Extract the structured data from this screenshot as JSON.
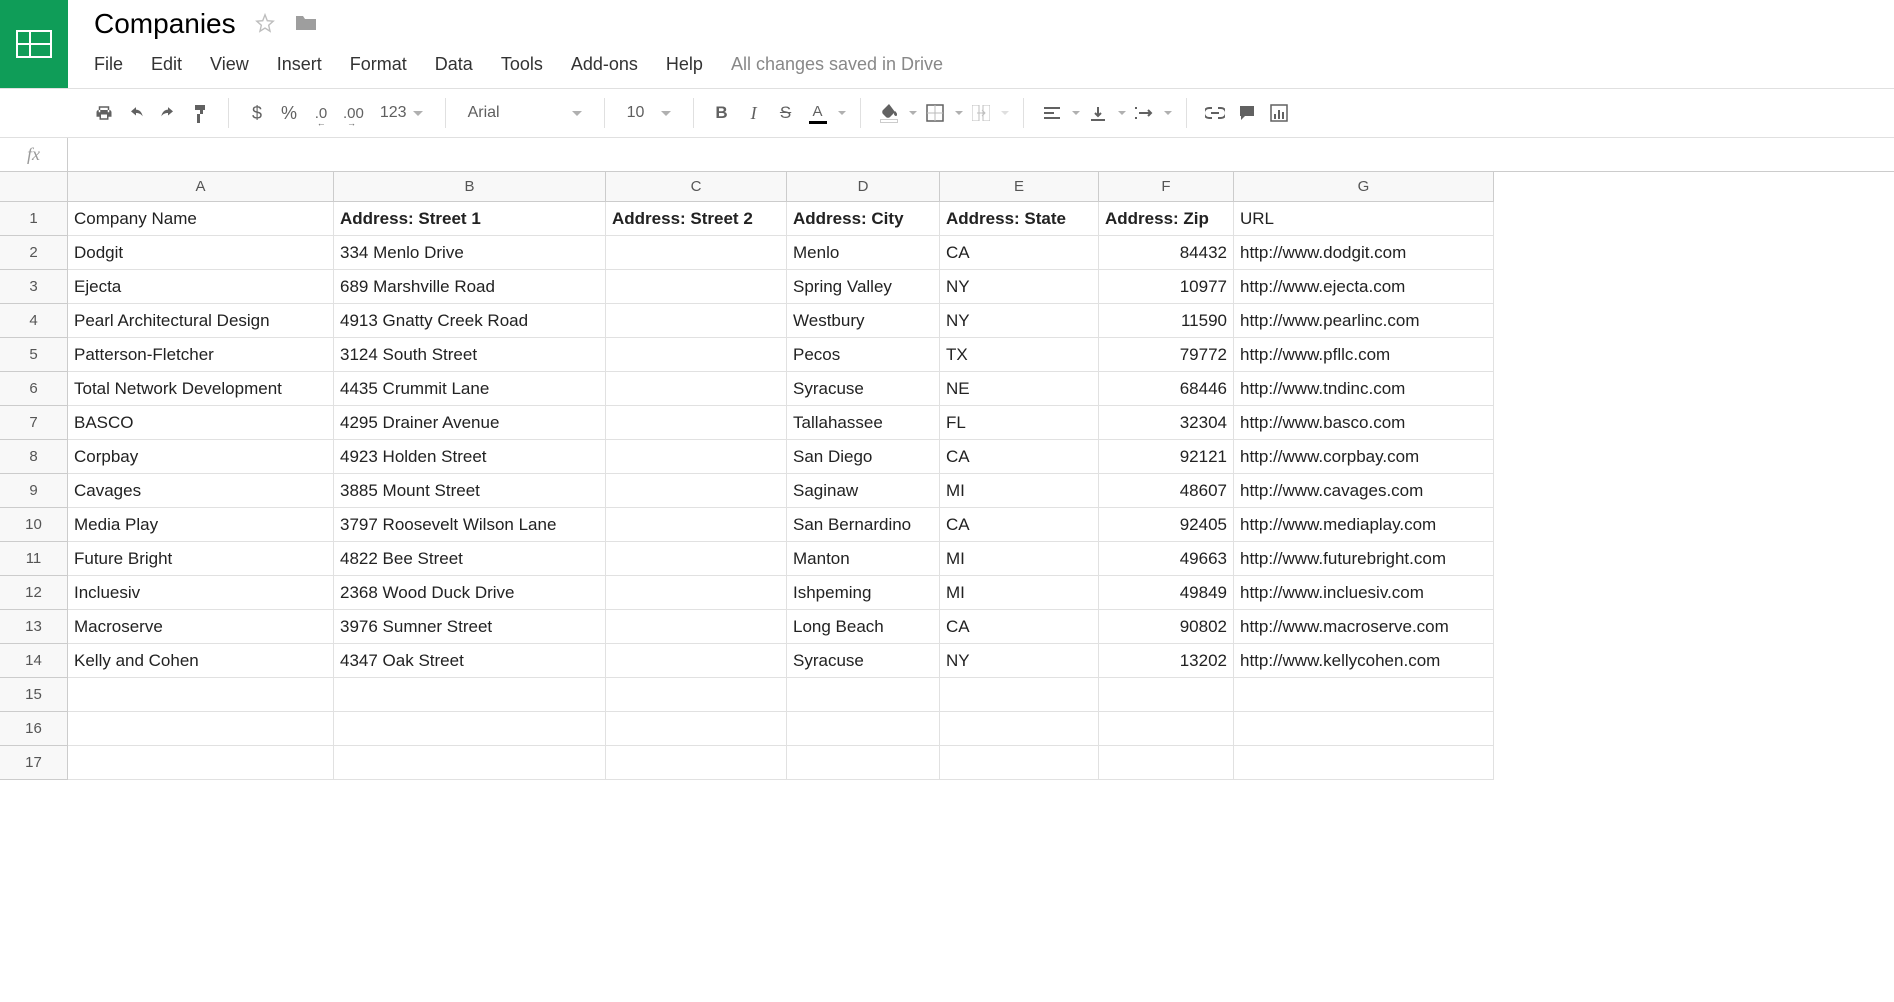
{
  "title": "Companies",
  "menu": {
    "file": "File",
    "edit": "Edit",
    "view": "View",
    "insert": "Insert",
    "format": "Format",
    "data": "Data",
    "tools": "Tools",
    "addons": "Add-ons",
    "help": "Help"
  },
  "save_status": "All changes saved in Drive",
  "toolbar": {
    "currency": "$",
    "percent": "%",
    "dec_dec": ".0",
    "dec_inc": ".00",
    "format_more": "123",
    "font": "Arial",
    "font_size": "10",
    "bold": "B",
    "italic": "I",
    "strike": "S"
  },
  "formula_label": "fx",
  "columns": [
    "A",
    "B",
    "C",
    "D",
    "E",
    "F",
    "G"
  ],
  "col_widths": [
    "cA",
    "cB",
    "cC",
    "cD",
    "cE",
    "cF",
    "cG"
  ],
  "headers": {
    "a": "Company Name",
    "b": "Address: Street 1",
    "c": "Address: Street 2",
    "d": "Address: City",
    "e": "Address: State",
    "f": "Address: Zip",
    "g": "URL"
  },
  "rows": [
    {
      "a": "Dodgit",
      "b": "334 Menlo Drive",
      "c": "",
      "d": "Menlo",
      "e": "CA",
      "f": "84432",
      "g": "http://www.dodgit.com"
    },
    {
      "a": "Ejecta",
      "b": "689 Marshville Road",
      "c": "",
      "d": "Spring Valley",
      "e": "NY",
      "f": "10977",
      "g": "http://www.ejecta.com"
    },
    {
      "a": "Pearl Architectural Design",
      "b": "4913 Gnatty Creek Road",
      "c": "",
      "d": "Westbury",
      "e": "NY",
      "f": "11590",
      "g": "http://www.pearlinc.com"
    },
    {
      "a": "Patterson-Fletcher",
      "b": "3124 South Street",
      "c": "",
      "d": "Pecos",
      "e": "TX",
      "f": "79772",
      "g": "http://www.pfllc.com"
    },
    {
      "a": "Total Network Development",
      "b": "4435 Crummit Lane",
      "c": "",
      "d": "Syracuse",
      "e": "NE",
      "f": "68446",
      "g": "http://www.tndinc.com"
    },
    {
      "a": "BASCO",
      "b": "4295 Drainer Avenue",
      "c": "",
      "d": "Tallahassee",
      "e": "FL",
      "f": "32304",
      "g": "http://www.basco.com"
    },
    {
      "a": "Corpbay",
      "b": "4923 Holden Street",
      "c": "",
      "d": "San Diego",
      "e": "CA",
      "f": "92121",
      "g": "http://www.corpbay.com"
    },
    {
      "a": "Cavages",
      "b": "3885 Mount Street",
      "c": "",
      "d": "Saginaw",
      "e": "MI",
      "f": "48607",
      "g": "http://www.cavages.com"
    },
    {
      "a": "Media Play",
      "b": "3797 Roosevelt Wilson Lane",
      "c": "",
      "d": "San Bernardino",
      "e": "CA",
      "f": "92405",
      "g": "http://www.mediaplay.com"
    },
    {
      "a": "Future Bright",
      "b": "4822 Bee Street",
      "c": "",
      "d": "Manton",
      "e": "MI",
      "f": "49663",
      "g": "http://www.futurebright.com"
    },
    {
      "a": "Incluesiv",
      "b": "2368 Wood Duck Drive",
      "c": "",
      "d": "Ishpeming",
      "e": "MI",
      "f": "49849",
      "g": "http://www.incluesiv.com"
    },
    {
      "a": "Macroserve",
      "b": "3976 Sumner Street",
      "c": "",
      "d": "Long Beach",
      "e": "CA",
      "f": "90802",
      "g": "http://www.macroserve.com"
    },
    {
      "a": "Kelly and Cohen",
      "b": "4347 Oak Street",
      "c": "",
      "d": "Syracuse",
      "e": "NY",
      "f": "13202",
      "g": "http://www.kellycohen.com"
    }
  ],
  "empty_rows": [
    15,
    16,
    17
  ]
}
